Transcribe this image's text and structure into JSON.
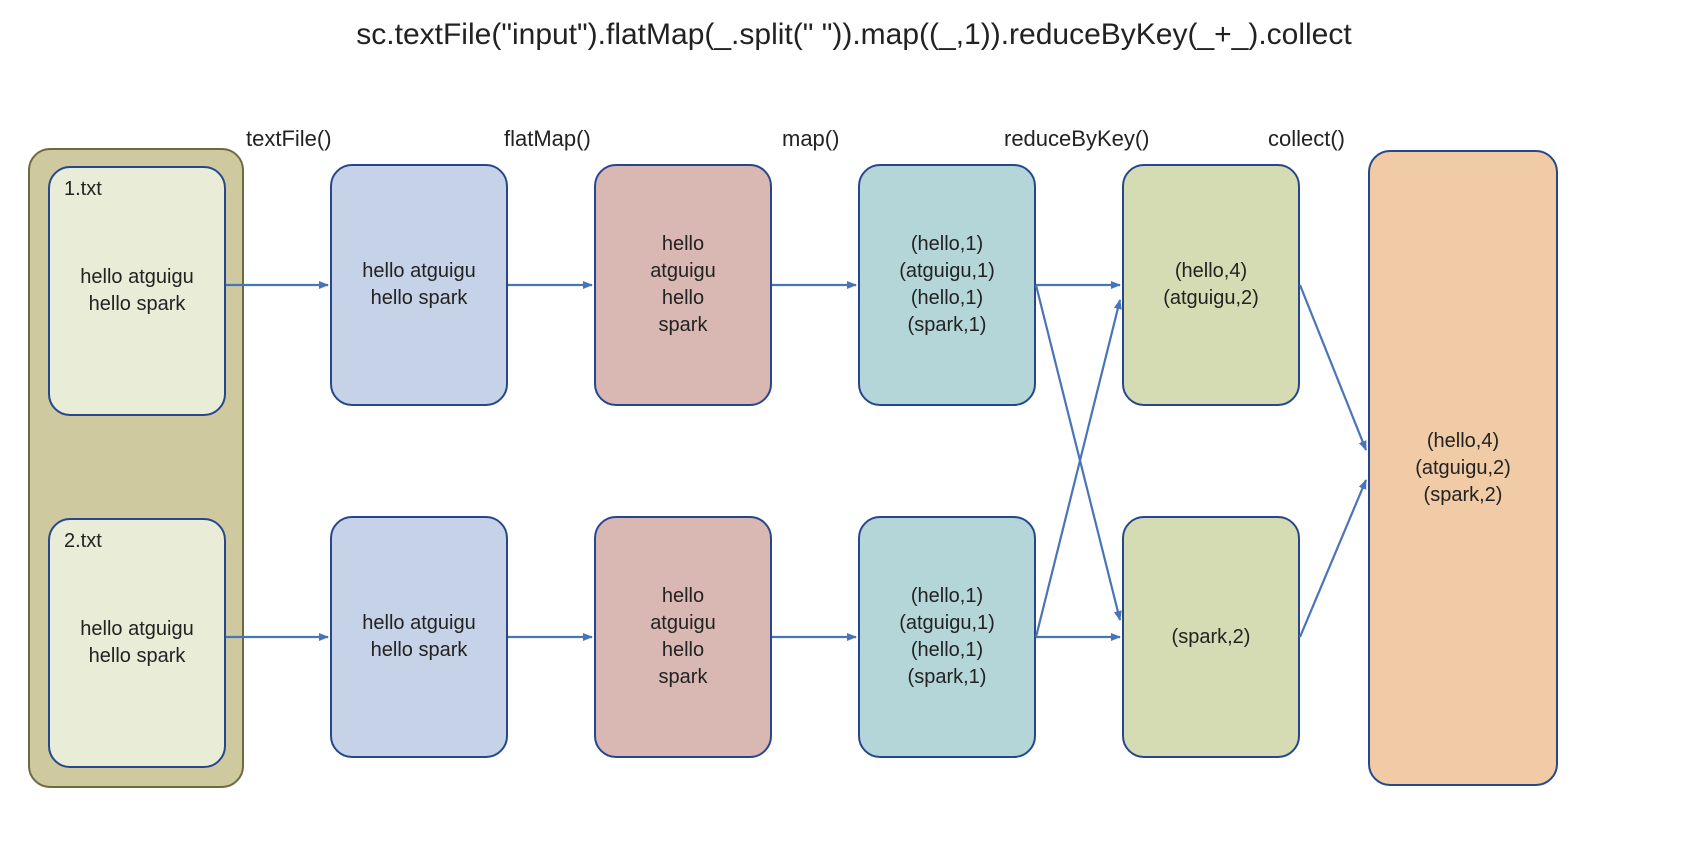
{
  "title": "sc.textFile(\"input\").flatMap(_.split(\" \")).map((_,1)).reduceByKey(_+_).collect",
  "stages": {
    "textFile": "textFile()",
    "flatMap": "flatMap()",
    "map": "map()",
    "reduceByKey": "reduceByKey()",
    "collect": "collect()"
  },
  "files": {
    "file1": {
      "name": "1.txt",
      "line1": "hello atguigu",
      "line2": "hello spark"
    },
    "file2": {
      "name": "2.txt",
      "line1": "hello atguigu",
      "line2": "hello spark"
    }
  },
  "textFileOut": {
    "r1": {
      "line1": "hello atguigu",
      "line2": "hello spark"
    },
    "r2": {
      "line1": "hello atguigu",
      "line2": "hello spark"
    }
  },
  "flatMapOut": {
    "r1": {
      "l1": "hello",
      "l2": "atguigu",
      "l3": "hello",
      "l4": "spark"
    },
    "r2": {
      "l1": "hello",
      "l2": "atguigu",
      "l3": "hello",
      "l4": "spark"
    }
  },
  "mapOut": {
    "r1": {
      "l1": "(hello,1)",
      "l2": "(atguigu,1)",
      "l3": "(hello,1)",
      "l4": "(spark,1)"
    },
    "r2": {
      "l1": "(hello,1)",
      "l2": "(atguigu,1)",
      "l3": "(hello,1)",
      "l4": "(spark,1)"
    }
  },
  "reduceOut": {
    "r1": {
      "l1": "(hello,4)",
      "l2": "(atguigu,2)"
    },
    "r2": {
      "l1": "(spark,2)"
    }
  },
  "collectOut": {
    "l1": "(hello,4)",
    "l2": "(atguigu,2)",
    "l3": "(spark,2)"
  },
  "colors": {
    "arrow": "#4a74b8"
  }
}
